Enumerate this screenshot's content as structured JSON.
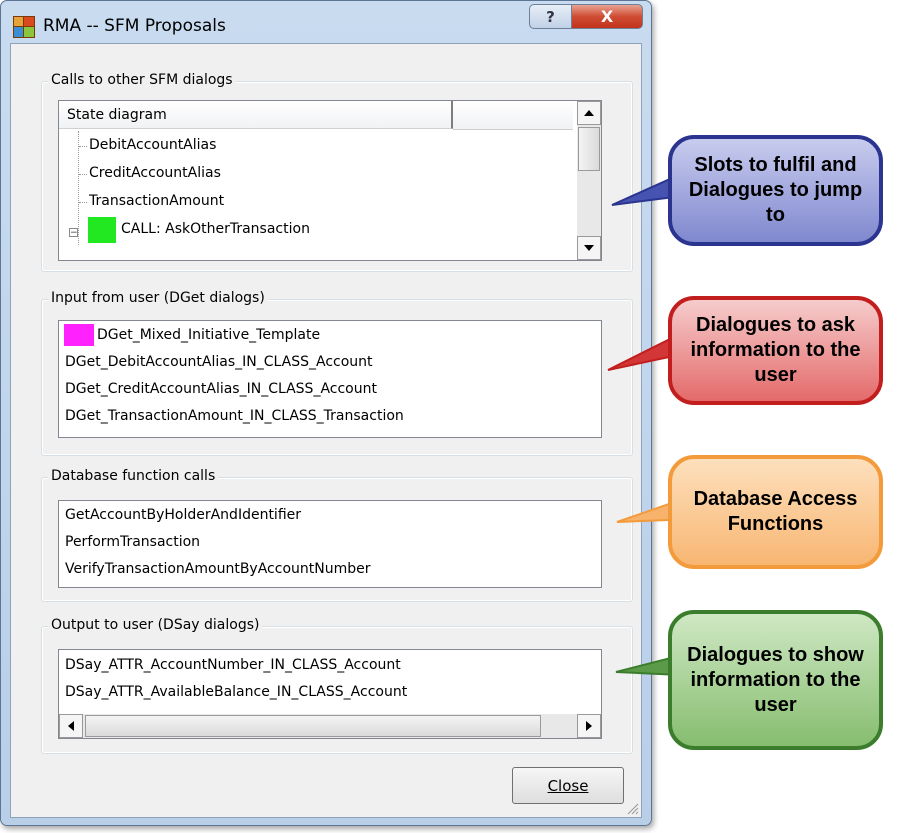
{
  "window": {
    "title": "RMA -- SFM Proposals",
    "help_glyph": "?",
    "close_glyph": "X"
  },
  "group_calls": {
    "label": "Calls to other SFM dialogs",
    "header": "State diagram",
    "items": [
      "DebitAccountAlias",
      "CreditAccountAlias",
      "TransactionAmount"
    ],
    "call_item": "CALL: AskOtherTransaction"
  },
  "group_input": {
    "label": "Input from user (DGet dialogs)",
    "items": [
      "DGet_Mixed_Initiative_Template",
      "DGet_DebitAccountAlias_IN_CLASS_Account",
      "DGet_CreditAccountAlias_IN_CLASS_Account",
      "DGet_TransactionAmount_IN_CLASS_Transaction"
    ]
  },
  "group_db": {
    "label": "Database function calls",
    "items": [
      "GetAccountByHolderAndIdentifier",
      "PerformTransaction",
      "VerifyTransactionAmountByAccountNumber"
    ]
  },
  "group_output": {
    "label": "Output to user (DSay dialogs)",
    "items": [
      "DSay_ATTR_AccountNumber_IN_CLASS_Account",
      "DSay_ATTR_AvailableBalance_IN_CLASS_Account"
    ]
  },
  "close_button": {
    "label": "Close"
  },
  "callouts": [
    {
      "text": "Slots to fulfil and Dialogues to jump to",
      "color": "#2b3590"
    },
    {
      "text": "Dialogues to ask information to the user",
      "color": "#c21e1e"
    },
    {
      "text": "Database Access Functions",
      "color": "#f39a3b"
    },
    {
      "text": "Dialogues to show information to the user",
      "color": "#3b7d2c"
    }
  ],
  "colors": {
    "call_swatch": "#22e822",
    "dget_swatch": "#ff22ff"
  }
}
